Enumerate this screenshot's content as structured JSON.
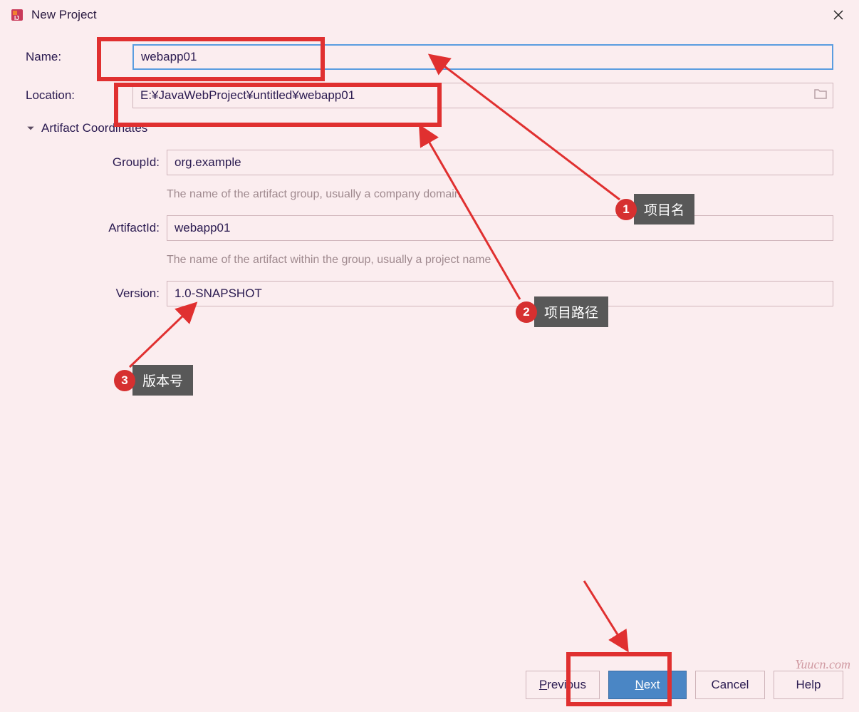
{
  "titlebar": {
    "title": "New Project"
  },
  "form": {
    "name_label": "Name:",
    "name_value": "webapp01",
    "location_label": "Location:",
    "location_value": "E:¥JavaWebProject¥untitled¥webapp01",
    "artifact_section": "Artifact Coordinates",
    "groupid_label": "GroupId:",
    "groupid_value": "org.example",
    "groupid_hint": "The name of the artifact group, usually a company domain",
    "artifactid_label": "ArtifactId:",
    "artifactid_value": "webapp01",
    "artifactid_hint": "The name of the artifact within the group, usually a project name",
    "version_label": "Version:",
    "version_value": "1.0-SNAPSHOT"
  },
  "footer": {
    "previous": "Previous",
    "next": "Next",
    "cancel": "Cancel",
    "help": "Help"
  },
  "annotations": {
    "a1": "项目名",
    "a2": "项目路径",
    "a3": "版本号"
  },
  "watermark": "Yuucn.com"
}
